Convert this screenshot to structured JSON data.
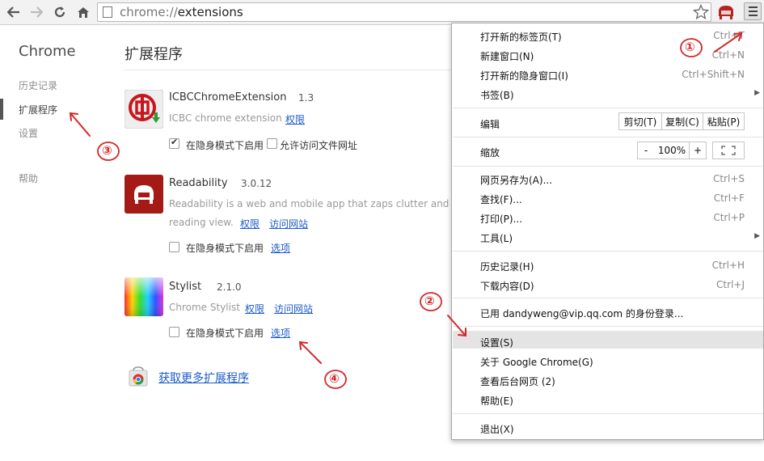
{
  "toolbar": {
    "url_scheme": "chrome://",
    "url_host": "extensions"
  },
  "sidebar": {
    "title": "Chrome",
    "items": [
      {
        "label": "历史记录"
      },
      {
        "label": "扩展程序"
      },
      {
        "label": "设置"
      },
      {
        "label": "帮助"
      }
    ]
  },
  "main": {
    "title": "扩展程序",
    "extensions": [
      {
        "name": "ICBCChromeExtension",
        "version": "1.3",
        "desc": "ICBC chrome extension",
        "links": [
          "权限"
        ],
        "incognito_label": "在隐身模式下启用",
        "incognito_checked": true,
        "file_access_label": "允许访问文件网址",
        "file_access_checked": false
      },
      {
        "name": "Readability",
        "version": "3.0.12",
        "desc1": "Readability is a web and mobile app that zaps clutter and sa",
        "desc2": "reading view.",
        "links": [
          "权限",
          "访问网站"
        ],
        "incognito_label": "在隐身模式下启用",
        "incognito_checked": false,
        "options_label": "选项"
      },
      {
        "name": "Stylist",
        "version": "2.1.0",
        "desc": "Chrome Stylist",
        "links": [
          "权限",
          "访问网站"
        ],
        "incognito_label": "在隐身模式下启用",
        "incognito_checked": false,
        "options_label": "选项"
      }
    ],
    "get_more": "获取更多扩展程序"
  },
  "menu": {
    "new_tab": "打开新的标签页(T)",
    "new_tab_sc": "Ctrl+T",
    "new_window": "新建窗口(N)",
    "new_window_sc": "Ctrl+N",
    "incognito": "打开新的隐身窗口(I)",
    "incognito_sc": "Ctrl+Shift+N",
    "bookmarks": "书签(B)",
    "edit": "编辑",
    "cut": "剪切(T)",
    "copy": "复制(C)",
    "paste": "粘贴(P)",
    "zoom": "缩放",
    "zoom_minus": "-",
    "zoom_value": "100%",
    "zoom_plus": "+",
    "save_as": "网页另存为(A)...",
    "save_as_sc": "Ctrl+S",
    "find": "查找(F)...",
    "find_sc": "Ctrl+F",
    "print": "打印(P)...",
    "print_sc": "Ctrl+P",
    "tools": "工具(L)",
    "history": "历史记录(H)",
    "history_sc": "Ctrl+H",
    "downloads": "下载内容(D)",
    "downloads_sc": "Ctrl+J",
    "signed_in": "已用 dandyweng@vip.qq.com 的身份登录...",
    "settings": "设置(S)",
    "about": "关于 Google Chrome(G)",
    "background": "查看后台网页 (2)",
    "help": "帮助(E)",
    "exit": "退出(X)"
  },
  "annotations": [
    "①",
    "②",
    "③",
    "④"
  ],
  "colors": {
    "link": "#1a5bc9",
    "annotation_red": "#d2282a",
    "highlight": "#e4e4e4"
  }
}
